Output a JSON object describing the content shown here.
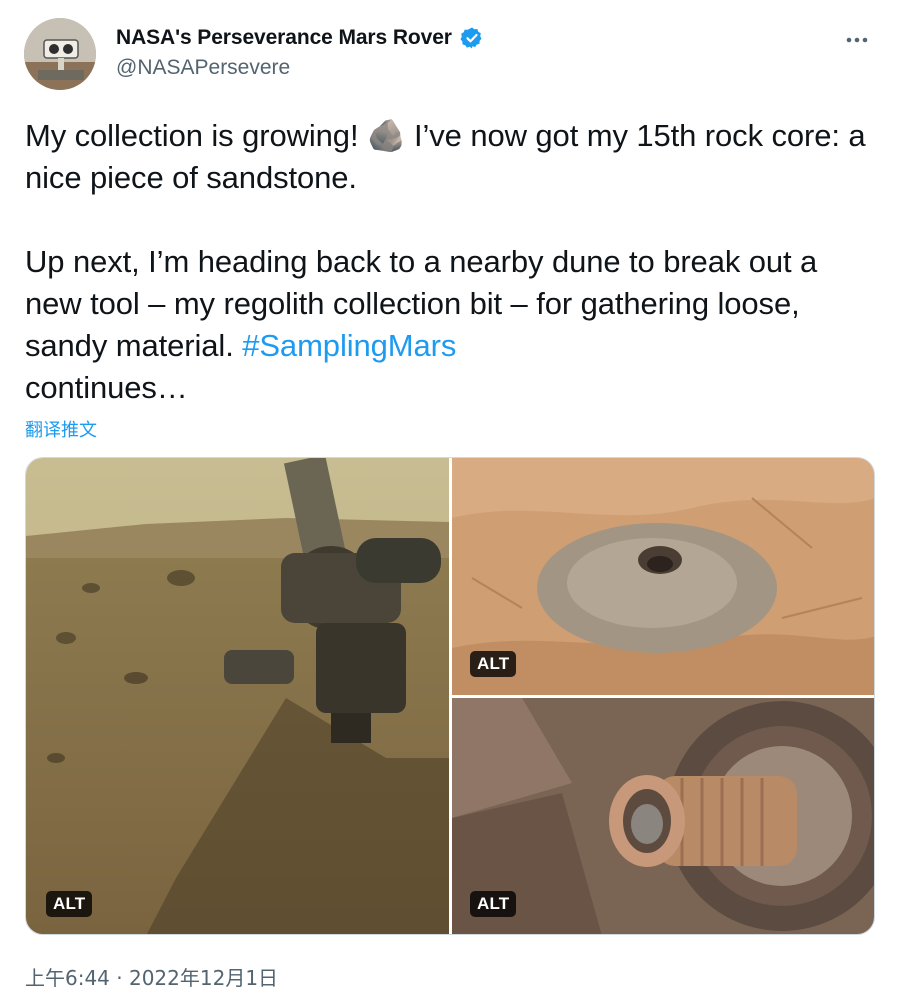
{
  "tweet": {
    "author": {
      "display_name": "NASA's Perseverance Mars Rover",
      "handle": "@NASAPersevere",
      "verified": true,
      "avatar_icon": "rover-avatar",
      "verified_color": "#1d9bf0"
    },
    "more_icon": "more-horizontal-icon",
    "text_part1": "My collection is growing! 🪨 I’ve now got my 15th rock core: a nice piece of sandstone.\n\nUp next, I’m heading back to a nearby dune to break out a new tool – my regolith collection bit – for gathering loose, sandy material. ",
    "hashtag": "#SamplingMars",
    "text_part2": "\ncontinues…",
    "translate_label": "翻译推文",
    "media": [
      {
        "alt_badge": "ALT",
        "subject": "rover-arm-on-mars-terrain"
      },
      {
        "alt_badge": "ALT",
        "subject": "drill-hole-with-powder"
      },
      {
        "alt_badge": "ALT",
        "subject": "sample-core-tube"
      }
    ],
    "timestamp": "上午6:44 · 2022年12月1日",
    "colors": {
      "link": "#1d9bf0",
      "secondary_text": "#536471",
      "primary_text": "#0f1419"
    }
  }
}
